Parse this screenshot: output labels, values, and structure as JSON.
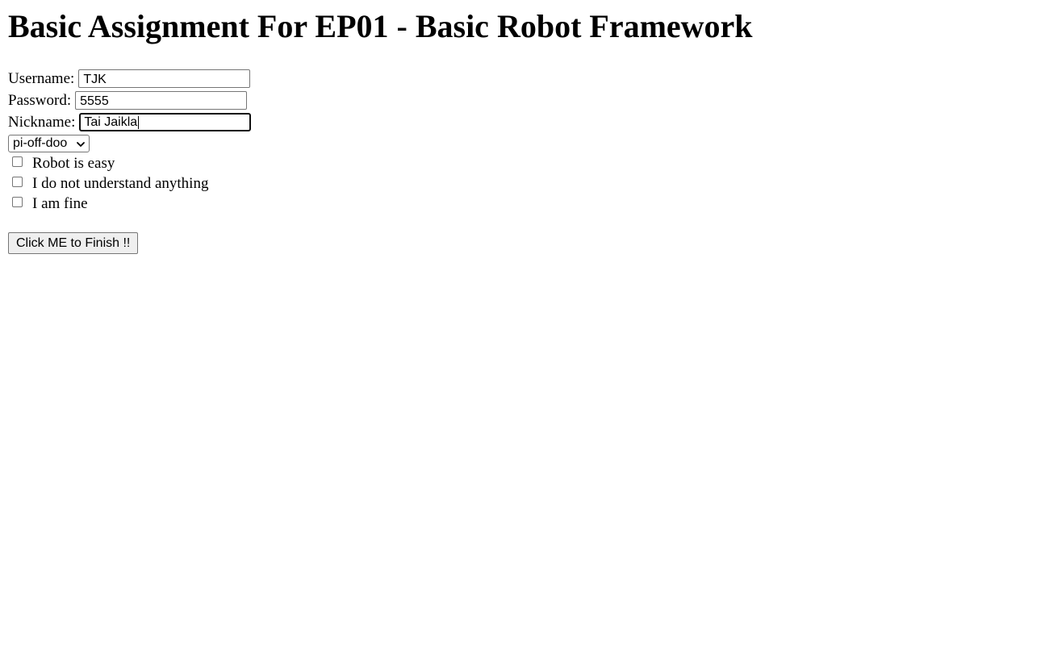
{
  "header": {
    "title": "Basic Assignment For EP01 - Basic Robot Framework"
  },
  "form": {
    "username": {
      "label": "Username:",
      "value": "TJK"
    },
    "password": {
      "label": "Password:",
      "value": "5555"
    },
    "nickname": {
      "label": "Nickname:",
      "value": "Tai Jaikla"
    },
    "dropdown": {
      "selected": "pi-off-doo"
    },
    "checkboxes": [
      {
        "label": "Robot is easy",
        "checked": false
      },
      {
        "label": "I do not understand anything",
        "checked": false
      },
      {
        "label": "I am fine",
        "checked": false
      }
    ],
    "submit_label": "Click ME to Finish !!"
  },
  "icons": {
    "dropdown_arrow": "chevron-down-icon"
  }
}
